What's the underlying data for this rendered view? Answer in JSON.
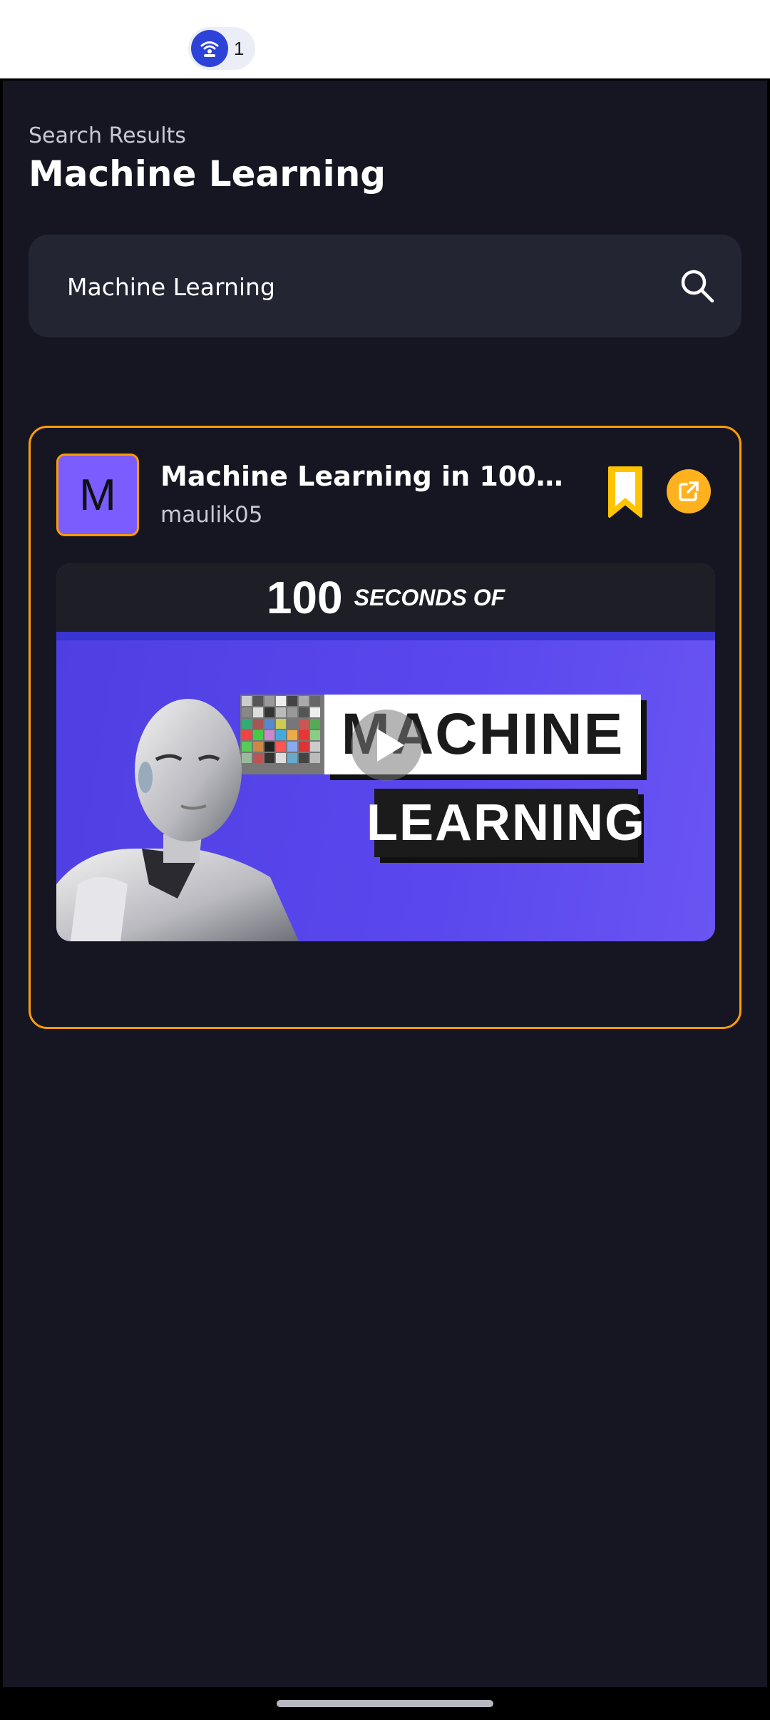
{
  "status_bar": {
    "hotspot_count": "1",
    "icon": "wifi-hotspot-icon"
  },
  "header": {
    "subtitle": "Search Results",
    "title": "Machine Learning"
  },
  "search": {
    "value": "Machine Learning",
    "icon": "search-icon"
  },
  "results": [
    {
      "avatar_letter": "M",
      "title": "Machine Learning in 100 seco...",
      "creator": "maulik05",
      "thumbnail": {
        "banner_number": "100",
        "banner_text": "SECONDS OF",
        "word1": "MACHINE",
        "word2": "LEARNING"
      }
    }
  ],
  "colors": {
    "background": "#161622",
    "accent": "#ff9c01",
    "bookmark": "#ffc400",
    "avatar": "#7b5cff",
    "search_bg": "#232533"
  }
}
